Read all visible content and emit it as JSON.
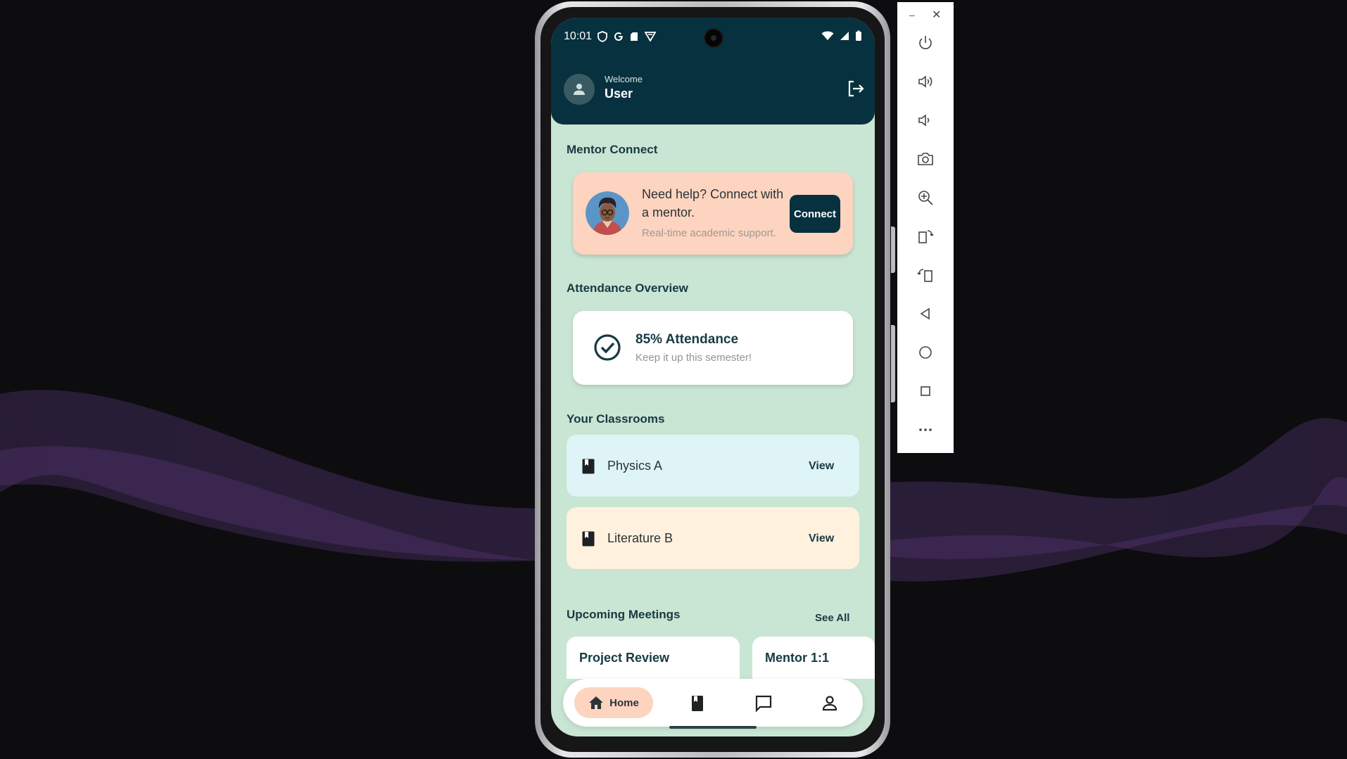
{
  "status_bar": {
    "time": "10:01",
    "left_icons": [
      "shield-icon",
      "google-icon",
      "sd-card-icon",
      "vpn-icon"
    ],
    "right_icons": [
      "wifi-icon",
      "signal-icon",
      "battery-icon"
    ]
  },
  "header": {
    "welcome_label": "Welcome",
    "user_name": "User"
  },
  "mentor": {
    "section_title": "Mentor Connect",
    "headline": "Need help? Connect with a mentor.",
    "subtitle": "Real-time academic support.",
    "button_label": "Connect"
  },
  "attendance": {
    "section_title": "Attendance Overview",
    "title": "85% Attendance",
    "percent": 85,
    "subtitle": "Keep it up this semester!"
  },
  "classrooms": {
    "section_title": "Your Classrooms",
    "items": [
      {
        "name": "Physics A",
        "action": "View",
        "color": "#def4f6"
      },
      {
        "name": "Literature B",
        "action": "View",
        "color": "#fff1de"
      }
    ]
  },
  "meetings": {
    "section_title": "Upcoming Meetings",
    "see_all": "See All",
    "items": [
      {
        "title": "Project Review"
      },
      {
        "title": "Mentor 1:1"
      }
    ]
  },
  "bottom_nav": {
    "home_label": "Home",
    "items": [
      "home-icon",
      "book-icon",
      "chat-icon",
      "profile-icon"
    ]
  },
  "emulator_panel": {
    "minimize_label": "–",
    "close_label": "✕",
    "buttons": [
      "power-icon",
      "volume-up-icon",
      "volume-down-icon",
      "camera-icon",
      "zoom-icon",
      "rotate-left-icon",
      "rotate-right-icon",
      "back-icon",
      "home-circle-icon",
      "overview-icon",
      "more-icon"
    ]
  },
  "colors": {
    "header_bg": "#08313f",
    "screen_bg": "#c9e5d3",
    "accent_peach": "#fdd4bf",
    "text_dark": "#173a43"
  }
}
